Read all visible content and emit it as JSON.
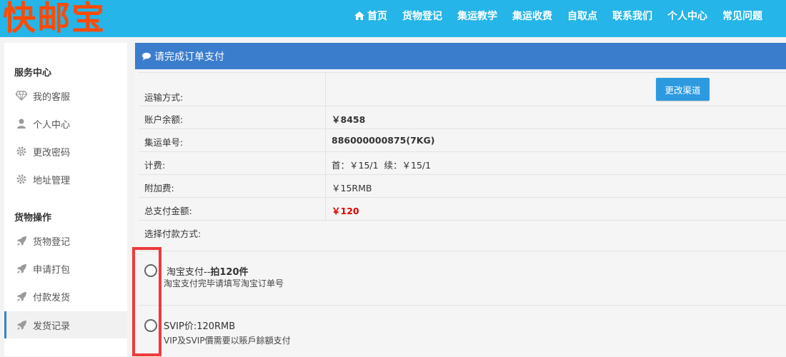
{
  "header": {
    "logo": "快邮宝",
    "nav": [
      "首页",
      "货物登记",
      "集运教学",
      "集运收费",
      "自取点",
      "联系我们",
      "个人中心",
      "常见问题"
    ]
  },
  "sidebar": {
    "groups": [
      {
        "title": "服务中心",
        "items": [
          "我的客服",
          "个人中心",
          "更改密码",
          "地址管理"
        ]
      },
      {
        "title": "货物操作",
        "items": [
          "货物登记",
          "申请打包",
          "付款发货",
          "发货记录"
        ]
      }
    ]
  },
  "panel": {
    "title": "请完成订单支付",
    "change_button": "更改渠道",
    "rows": [
      {
        "label": "运输方式:",
        "value": ""
      },
      {
        "label": "账户余额:",
        "value": "￥8458"
      },
      {
        "label": "集运单号:",
        "value": "886000000875(7KG)"
      },
      {
        "label": "计费:",
        "value": "首：￥15/1  续：￥15/1"
      },
      {
        "label": "附加费:",
        "value": "￥15RMB"
      },
      {
        "label": "总支付金额:",
        "value": "￥120"
      },
      {
        "label": "选择付款方式:",
        "value": ""
      }
    ],
    "payment_options": [
      {
        "title_prefix": "淘宝支付--",
        "title_bold": "拍120件",
        "subtitle": "淘宝支付完毕请填写淘宝订单号"
      },
      {
        "title_prefix": "SVIP价:120RMB",
        "title_bold": "",
        "subtitle": "VIP及SVIP價需要以賬戶餘額支付"
      }
    ]
  },
  "colors": {
    "topbar": "#25b5e8",
    "logo": "#ff4a00",
    "panel_head": "#3b7dcd",
    "button": "#2d9ae0",
    "total": "#e00000",
    "highlight": "#ee3a3a"
  }
}
